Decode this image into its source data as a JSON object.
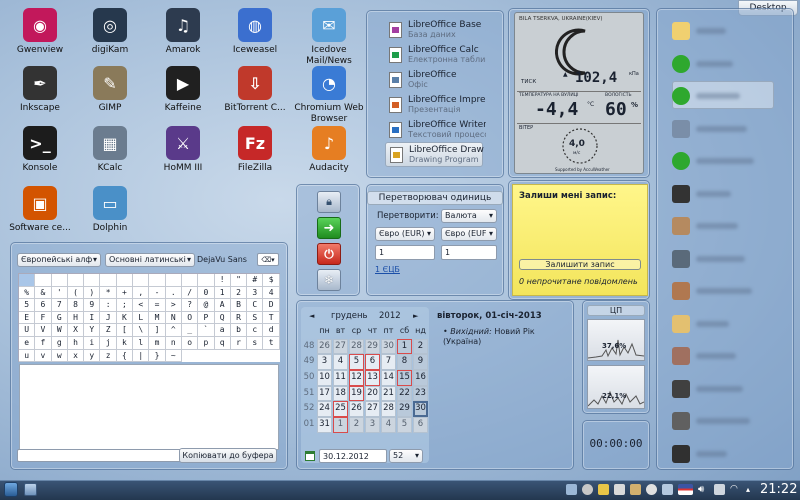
{
  "desktop_button": "Desktop",
  "desktop_icons": [
    {
      "label": "Gwenview",
      "icon": "gwenview-icon",
      "color": "#c2185b",
      "glyph": "◉"
    },
    {
      "label": "digiKam",
      "icon": "digikam-icon",
      "color": "#26384d",
      "glyph": "◎"
    },
    {
      "label": "Amarok",
      "icon": "amarok-icon",
      "color": "#2d3b4f",
      "glyph": "♫"
    },
    {
      "label": "Iceweasel",
      "icon": "iceweasel-icon",
      "color": "#3b6fcf",
      "glyph": "◍"
    },
    {
      "label": "Icedove Mail/News",
      "icon": "icedove-icon",
      "color": "#5aa0d8",
      "glyph": "✉"
    },
    {
      "label": "Inkscape",
      "icon": "inkscape-icon",
      "color": "#333333",
      "glyph": "✒"
    },
    {
      "label": "GIMP",
      "icon": "gimp-icon",
      "color": "#8a7a5a",
      "glyph": "✎"
    },
    {
      "label": "Kaffeine",
      "icon": "kaffeine-icon",
      "color": "#202020",
      "glyph": "▶"
    },
    {
      "label": "BitTorrent C...",
      "icon": "bittorrent-icon",
      "color": "#c0392b",
      "glyph": "⇩"
    },
    {
      "label": "Chromium Web Browser",
      "icon": "chromium-icon",
      "color": "#3a7bd5",
      "glyph": "◔"
    },
    {
      "label": "Konsole",
      "icon": "konsole-icon",
      "color": "#1c1c1c",
      "glyph": ">_"
    },
    {
      "label": "KCalc",
      "icon": "kcalc-icon",
      "color": "#6b7c8f",
      "glyph": "▦"
    },
    {
      "label": "HoMM III",
      "icon": "homm-icon",
      "color": "#5a3a8a",
      "glyph": "⚔"
    },
    {
      "label": "FileZilla",
      "icon": "filezilla-icon",
      "color": "#c62828",
      "glyph": "Fz"
    },
    {
      "label": "Audacity",
      "icon": "audacity-icon",
      "color": "#e67e22",
      "glyph": "♪"
    },
    {
      "label": "Software ce...",
      "icon": "software-center-icon",
      "color": "#d35400",
      "glyph": "▣"
    },
    {
      "label": "Dolphin",
      "icon": "dolphin-icon",
      "color": "#4a90c8",
      "glyph": "▭"
    }
  ],
  "libreoffice": [
    {
      "title": "LibreOffice Base",
      "subtitle": "База даних",
      "color": "#a33ea1"
    },
    {
      "title": "LibreOffice Calc",
      "subtitle": "Електронна таблиця",
      "color": "#1e9e4a"
    },
    {
      "title": "LibreOffice",
      "subtitle": "Офіс",
      "color": "#5a7fa8"
    },
    {
      "title": "LibreOffice Impress",
      "subtitle": "Презентація",
      "color": "#d35f25"
    },
    {
      "title": "LibreOffice Writer",
      "subtitle": "Текстовий процесор",
      "color": "#2a6fc2"
    },
    {
      "title": "LibreOffice Draw",
      "subtitle": "Drawing Program",
      "color": "#d9a321"
    }
  ],
  "weather": {
    "location": "BILA TSERKVA, UKRAINE(KIEV)",
    "pressure_label": "ТИСК",
    "pressure_value": "102,4",
    "pressure_unit": "кПа",
    "temp_label": "ТЕМПЕРАТУРА НА ВУЛИЦІ",
    "temp_value": "-4,4",
    "temp_unit": "°C",
    "humidity_label": "ВОЛОГІСТЬ",
    "humidity_value": "60",
    "humidity_unit": "%",
    "wind_label": "ВІТЕР",
    "wind_value": "4,0",
    "wind_unit": "м/с",
    "footer": "Supported by AccuWeather"
  },
  "quick_actions": [
    {
      "name": "lock-screen-button",
      "icon": "lock-icon"
    },
    {
      "name": "switch-user-button",
      "icon": "arrow-icon"
    },
    {
      "name": "shutdown-button",
      "icon": "power-icon"
    },
    {
      "name": "sleep-button",
      "icon": "snowflake-icon"
    }
  ],
  "converter": {
    "title": "Перетворювач одиниць",
    "convert_label": "Перетворити:",
    "category": "Валюта",
    "from_unit": "Євро (EUR)",
    "to_unit": "Євро (EUF",
    "from_value": "1",
    "to_value": "1",
    "link": "1 ЄЦБ"
  },
  "note": {
    "title": "Залиши мені запис:",
    "button": "Залишити запис",
    "status": "0 непрочитане повідомлень"
  },
  "charmap": {
    "alphabet": "Європейські алф",
    "script": "Основні латинські",
    "font": "DejaVu Sans",
    "chars": [
      "",
      "",
      "",
      "",
      "",
      "",
      "",
      "",
      "",
      "",
      "",
      "",
      "!",
      "\"",
      "#",
      "$",
      "%",
      "&",
      "'",
      "(",
      ")",
      "*",
      "+",
      ",",
      "-",
      ".",
      "/",
      "0",
      "1",
      "2",
      "3",
      "4",
      "5",
      "6",
      "7",
      "8",
      "9",
      ":",
      ";",
      "<",
      "=",
      ">",
      "?",
      "@",
      "A",
      "B",
      "C",
      "D",
      "E",
      "F",
      "G",
      "H",
      "I",
      "J",
      "K",
      "L",
      "M",
      "N",
      "O",
      "P",
      "Q",
      "R",
      "S",
      "T",
      "U",
      "V",
      "W",
      "X",
      "Y",
      "Z",
      "[",
      "\\",
      "]",
      "^",
      "_",
      "`",
      "a",
      "b",
      "c",
      "d",
      "e",
      "f",
      "g",
      "h",
      "i",
      "j",
      "k",
      "l",
      "m",
      "n",
      "o",
      "p",
      "q",
      "r",
      "s",
      "t",
      "u",
      "v",
      "w",
      "x",
      "y",
      "z",
      "{",
      "|",
      "}",
      "~"
    ],
    "copy_button": "Копіювати до буфера"
  },
  "calendar": {
    "prev": "◄",
    "month": "грудень",
    "year": "2012",
    "next": "►",
    "headers": [
      "пн",
      "вт",
      "ср",
      "чт",
      "пт",
      "сб",
      "нд"
    ],
    "weeks": [
      {
        "wk": "48",
        "days": [
          "26",
          "27",
          "28",
          "29",
          "30",
          "1",
          "2"
        ]
      },
      {
        "wk": "49",
        "days": [
          "3",
          "4",
          "5",
          "6",
          "7",
          "8",
          "9"
        ]
      },
      {
        "wk": "50",
        "days": [
          "10",
          "11",
          "12",
          "13",
          "14",
          "15",
          "16"
        ]
      },
      {
        "wk": "51",
        "days": [
          "17",
          "18",
          "19",
          "20",
          "21",
          "22",
          "23"
        ]
      },
      {
        "wk": "52",
        "days": [
          "24",
          "25",
          "26",
          "27",
          "28",
          "29",
          "30"
        ]
      },
      {
        "wk": "01",
        "days": [
          "31",
          "1",
          "2",
          "3",
          "4",
          "5",
          "6"
        ]
      }
    ],
    "date_input": "30.12.2012",
    "week_input": "52",
    "event_date": "вівторок, 01-січ-2013",
    "event_label": "Вихідний:",
    "event_text": "Новий Рік (Україна)"
  },
  "cpu": {
    "title": "ЦП",
    "value1": "37,6%",
    "value2": "22,1%"
  },
  "timer": "00:00:00",
  "contacts": [
    {
      "status": "#f0d070"
    },
    {
      "status": "#2ea82e"
    },
    {
      "status": "#2ea82e"
    },
    {
      "status": "#7a8ea8"
    },
    {
      "status": "#2ea82e"
    },
    {
      "status": "#333333"
    },
    {
      "status": "#b58a60"
    },
    {
      "status": "#5a6a7a"
    },
    {
      "status": "#b07850"
    },
    {
      "status": "#e3c070"
    },
    {
      "status": "#a07060"
    },
    {
      "status": "#404040"
    },
    {
      "status": "#606060"
    },
    {
      "status": "#303030"
    }
  ],
  "clock": "21:22"
}
